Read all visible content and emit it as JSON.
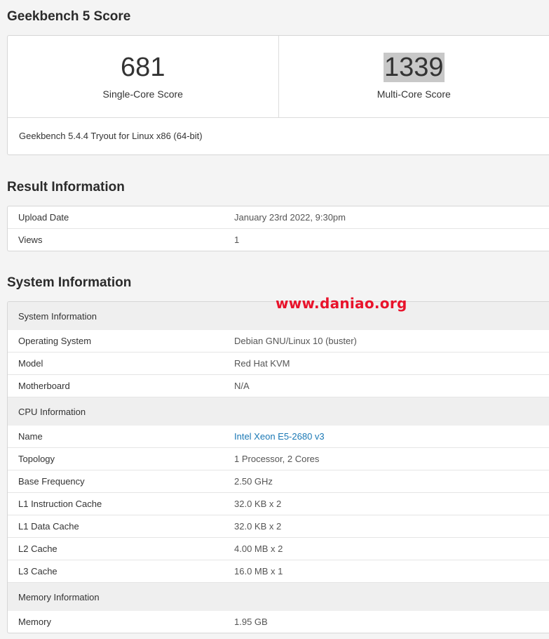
{
  "geekbench": {
    "title": "Geekbench 5 Score",
    "single_core_score": "681",
    "single_core_label": "Single-Core Score",
    "multi_core_score": "1339",
    "multi_core_label": "Multi-Core Score",
    "version": "Geekbench 5.4.4 Tryout for Linux x86 (64-bit)"
  },
  "result": {
    "title": "Result Information",
    "rows": [
      {
        "label": "Upload Date",
        "value": "January 23rd 2022, 9:30pm"
      },
      {
        "label": "Views",
        "value": "1"
      }
    ]
  },
  "system": {
    "title": "System Information",
    "section_system": "System Information",
    "system_rows": [
      {
        "label": "Operating System",
        "value": "Debian GNU/Linux 10 (buster)"
      },
      {
        "label": "Model",
        "value": "Red Hat KVM"
      },
      {
        "label": "Motherboard",
        "value": "N/A"
      }
    ],
    "section_cpu": "CPU Information",
    "cpu_rows": [
      {
        "label": "Name",
        "value": "Intel Xeon E5-2680 v3"
      },
      {
        "label": "Topology",
        "value": "1 Processor, 2 Cores"
      },
      {
        "label": "Base Frequency",
        "value": "2.50 GHz"
      },
      {
        "label": "L1 Instruction Cache",
        "value": "32.0 KB x 2"
      },
      {
        "label": "L1 Data Cache",
        "value": "32.0 KB x 2"
      },
      {
        "label": "L2 Cache",
        "value": "4.00 MB x 2"
      },
      {
        "label": "L3 Cache",
        "value": "16.0 MB x 1"
      }
    ],
    "section_memory": "Memory Information",
    "memory_rows": [
      {
        "label": "Memory",
        "value": "1.95 GB"
      }
    ]
  },
  "watermark": "www.daniao.org",
  "colors": {
    "link": "#1a78b5",
    "watermark": "#e8132b",
    "selection_highlight": "#c8c8c8"
  }
}
